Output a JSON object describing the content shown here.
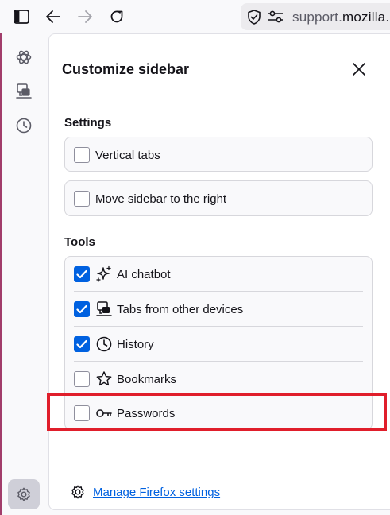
{
  "toolbar": {
    "url_prefix": "support.",
    "url_domain": "mozilla."
  },
  "panel": {
    "title": "Customize sidebar",
    "settings_heading": "Settings",
    "settings": [
      {
        "label": "Vertical tabs",
        "checked": false
      },
      {
        "label": "Move sidebar to the right",
        "checked": false
      }
    ],
    "tools_heading": "Tools",
    "tools": [
      {
        "label": "AI chatbot",
        "checked": true,
        "icon": "sparkle-icon"
      },
      {
        "label": "Tabs from other devices",
        "checked": true,
        "icon": "synced-tabs-icon"
      },
      {
        "label": "History",
        "checked": true,
        "icon": "history-icon"
      },
      {
        "label": "Bookmarks",
        "checked": false,
        "icon": "star-icon"
      },
      {
        "label": "Passwords",
        "checked": false,
        "icon": "key-icon"
      }
    ],
    "manage_link": "Manage Firefox settings"
  },
  "colors": {
    "accent": "#0061e0",
    "highlight": "#e01e2b",
    "panel_bg": "#ffffff",
    "card_bg": "#f9f9fb"
  }
}
